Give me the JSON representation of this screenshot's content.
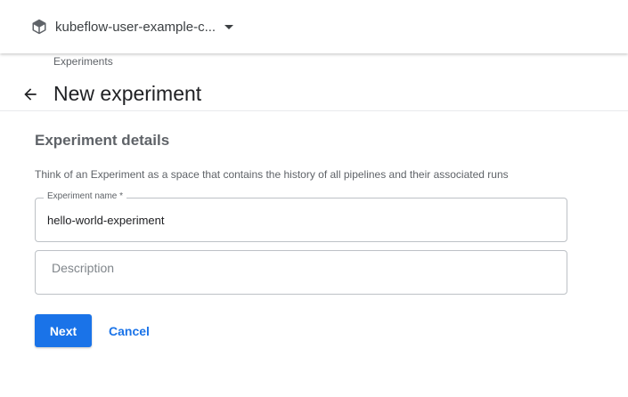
{
  "header": {
    "namespace_label": "kubeflow-user-example-c...",
    "namespace_icon": "cube-icon",
    "dropdown_icon": "caret-down-icon"
  },
  "breadcrumb": {
    "label": "Experiments"
  },
  "page": {
    "title": "New experiment",
    "back_icon": "arrow-back-icon"
  },
  "form": {
    "section_title": "Experiment details",
    "section_description": "Think of an Experiment as a space that contains the history of all pipelines and their associated runs",
    "name_field": {
      "label": "Experiment name *",
      "value": "hello-world-experiment"
    },
    "description_field": {
      "placeholder": "Description",
      "value": ""
    }
  },
  "actions": {
    "next_label": "Next",
    "cancel_label": "Cancel"
  },
  "colors": {
    "accent": "#1a73e8",
    "text_secondary": "#5f6368"
  }
}
